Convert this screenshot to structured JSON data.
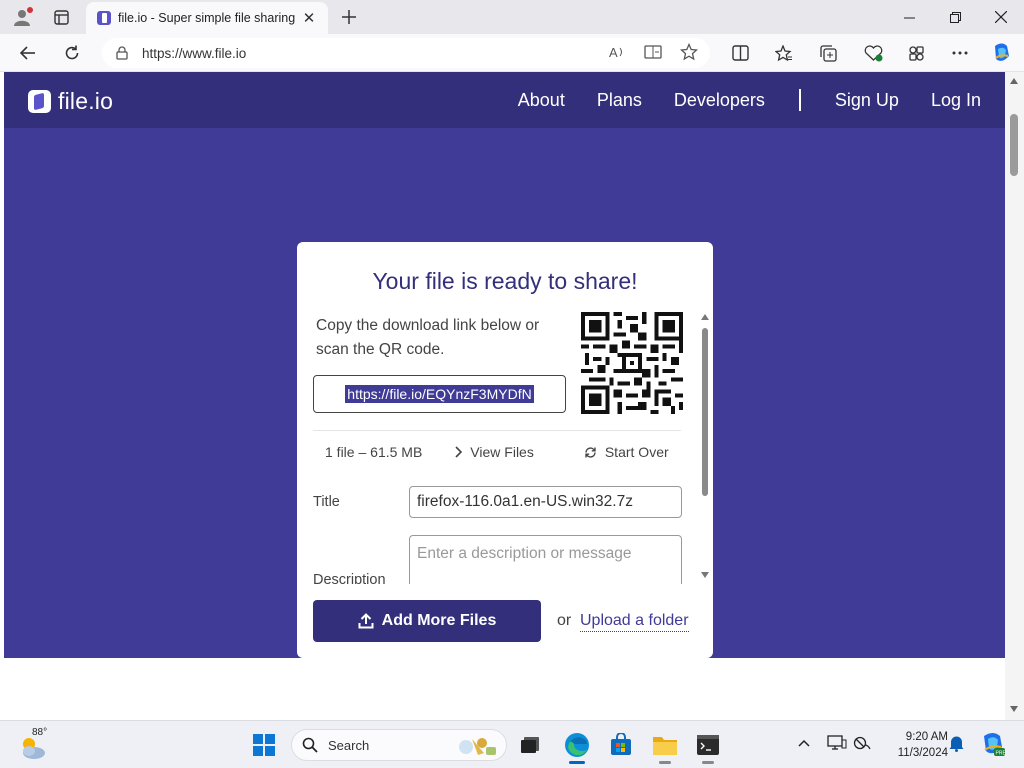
{
  "browser": {
    "tab_title": "file.io - Super simple file sharing",
    "url": "https://www.file.io",
    "colors": {
      "accent_copilot": "#1f6feb",
      "notification_dot": "#d13438"
    }
  },
  "site": {
    "logo_text": "file.io",
    "nav": {
      "about": "About",
      "plans": "Plans",
      "developers": "Developers",
      "signup": "Sign Up",
      "login": "Log In"
    },
    "colors": {
      "brand": "#332f7a",
      "background": "#3f3b96"
    }
  },
  "card": {
    "title": "Your file is ready to share!",
    "description": "Copy the download link below or scan the QR code.",
    "link": "https://file.io/EQYnzF3MYDfN",
    "file_count": "1 file",
    "file_size": "61.5 MB",
    "separator": "–",
    "view_files": "View Files",
    "start_over": "Start Over",
    "title_label": "Title",
    "title_value": "firefox-116.0a1.en-US.win32.7z",
    "description_label": "Description",
    "description_placeholder": "Enter a description or message",
    "add_button": "Add More Files",
    "or_text": "or",
    "upload_folder": "Upload a folder"
  },
  "taskbar": {
    "temperature": "88°",
    "search_text": "Search",
    "time": "9:20 AM",
    "date": "11/3/2024",
    "icons": [
      "weather-icon",
      "start-icon",
      "search-icon",
      "task-view-icon",
      "edge-icon",
      "store-icon",
      "file-explorer-icon",
      "terminal-icon",
      "tray-overflow-icon",
      "display-icon",
      "network-icon",
      "notification-bell-icon",
      "copilot-icon"
    ]
  }
}
